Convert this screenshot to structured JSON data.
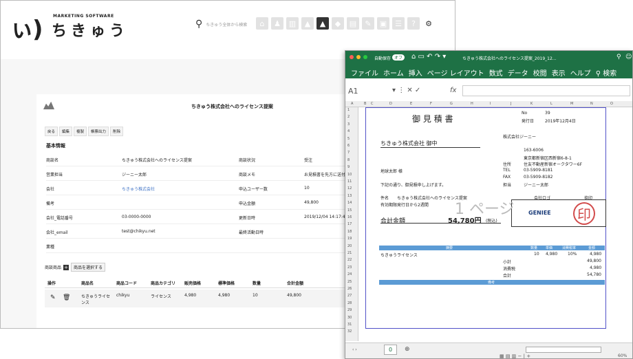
{
  "crm": {
    "logo_mark": "ぃ)",
    "logo_sub": "MARKETING SOFTWARE",
    "logo_name": "ちきゅう",
    "search_placeholder": "ちきゅう全体から検索",
    "toolbar_icons": [
      "home-icon",
      "user-icon",
      "building-icon",
      "chart-icon",
      "briefcase-icon",
      "box-icon",
      "clipboard-icon",
      "pencil-icon",
      "image-icon",
      "list-icon",
      "help-icon",
      "gear-icon"
    ],
    "page_title": "ちきゅう株式会社へのライセンス提案",
    "buttons": [
      "戻る",
      "編集",
      "複製",
      "帳票出力",
      "削除"
    ],
    "section_title": "基本情報",
    "fields": [
      {
        "label": "商談名",
        "value": "ちきゅう株式会社へのライセンス提案",
        "label2": "商談状況",
        "value2": "受注"
      },
      {
        "label": "営業担当",
        "value": "ジーニー太郎",
        "label2": "商談メモ",
        "value2": "お見積書を先方に送付"
      },
      {
        "label": "会社",
        "value": "ちきゅう株式会社",
        "label2": "申込ユーザー数",
        "value2": "10"
      },
      {
        "label": "備考",
        "value": "",
        "label2": "申込金額",
        "value2": "49,800"
      },
      {
        "label": "会社_電話番号",
        "value": "03-0000-0000",
        "label2": "更新日時",
        "value2": "2019/12/04 14:17:49"
      },
      {
        "label": "会社_email",
        "value": "test@chikyu.net",
        "label2": "最終活動日時",
        "value2": ""
      },
      {
        "label": "業種",
        "value": "",
        "label2": "",
        "value2": ""
      }
    ],
    "products_label": "商談商品",
    "select_products": "商品を選択する",
    "product_headers": [
      "操作",
      "商品名",
      "商品コード",
      "商品カテゴリ",
      "販売価格",
      "標準価格",
      "数量",
      "合計金額"
    ],
    "product_row": {
      "name": "ちきゅうライセンス",
      "code": "chikyu",
      "category": "ライセンス",
      "price": "4,980",
      "std": "4,980",
      "qty": "10",
      "total": "49,800"
    }
  },
  "excel": {
    "autosave": "自動保存",
    "autosave_state": "オフ",
    "title": "ちきゅう株式会社へのライセンス提案_2019_12...",
    "menu": [
      "ファイル",
      "ホーム",
      "挿入",
      "ページ レイアウト",
      "数式",
      "データ",
      "校閲",
      "表示",
      "ヘルプ",
      "検索"
    ],
    "cell_ref": "A1",
    "fx": "fx",
    "cols": [
      "A",
      "B",
      "C",
      "D",
      "E",
      "F",
      "G",
      "H",
      "I",
      "J",
      "K",
      "L",
      "M",
      "N",
      "O"
    ],
    "rows": [
      "1",
      "2",
      "3",
      "4",
      "5",
      "6",
      "7",
      "8",
      "9",
      "10",
      "11",
      "12",
      "13",
      "14",
      "15",
      "16",
      "17",
      "18",
      "19",
      "20",
      "21",
      "22",
      "23",
      "24",
      "25",
      "26",
      "27",
      "28",
      "29",
      "30",
      "31",
      "32"
    ],
    "doc_title": "御 見 積 書",
    "no_label": "No",
    "no_value": "39",
    "date_label": "発行日",
    "date_value": "2019年12月4日",
    "customer": "ちきゅう株式会社 御中",
    "issuer": "株式会社ジーニー",
    "zip": "163-6006",
    "addr1": "東京都新宿区西新宿6-8-1",
    "addr_label": "住所",
    "addr2": "住友不動産新宿オークタワー6F",
    "contact": "地球太郎 様",
    "tel_label": "TEL",
    "tel": "03-5909-8181",
    "fax_label": "FAX",
    "fax": "03-5909-8182",
    "staff_label": "担当",
    "staff": "ジーニー太郎",
    "intro": "下記の通り、御見積申し上げます。",
    "subject_label": "件名",
    "subject": "ちきゅう株式会社へのライセンス提案",
    "validity_label": "有効期限",
    "validity": "発行日から2週間",
    "logo_label": "会社ロゴ",
    "stamp_label": "捺印",
    "company_logo": "GENIEE",
    "stamp": "印",
    "page_watermark": "1 ページ",
    "total_label": "合計金額",
    "total": "54,780円",
    "tax": "(税込)",
    "item_headers": [
      "摘要",
      "数量",
      "単価",
      "消費税率",
      "金額"
    ],
    "item": {
      "name": "ちきゅうライセンス",
      "qty": "10",
      "price": "4,980",
      "rate": "10%",
      "amount": "4,980"
    },
    "subtotal_label": "小計",
    "subtotal": "49,800",
    "taxrow_label": "消費税",
    "taxrow": "4,980",
    "sum_label": "合計",
    "sum": "54,780",
    "remarks_label": "備考",
    "sheet_tab": "0",
    "zoom": "60%"
  }
}
